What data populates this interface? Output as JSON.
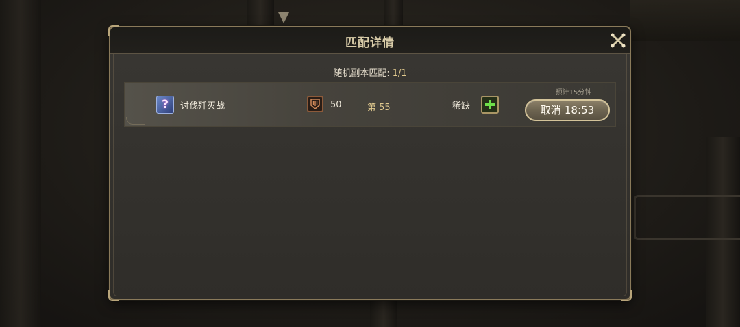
{
  "dialog": {
    "title": "匹配详情",
    "close_icon": "close-x-icon"
  },
  "summary": {
    "label": "随机副本匹配:",
    "count": "1/1"
  },
  "match_row": {
    "quest_icon": "question-mark-icon",
    "quest_icon_glyph": "?",
    "quest_name": "讨伐歼灭战",
    "level_icon": "level-badge-icon",
    "level_value": "50",
    "rank": "第 55",
    "scarce_label": "稀缺",
    "scarce_icon": "healer-plus-icon",
    "eta": "预计15分钟",
    "cancel_label": "取消",
    "cancel_timer": "18:53"
  },
  "colors": {
    "accent_gold": "#e0c98e",
    "frame_gold": "#8a7a5a",
    "healer_green": "#6ee04a"
  }
}
